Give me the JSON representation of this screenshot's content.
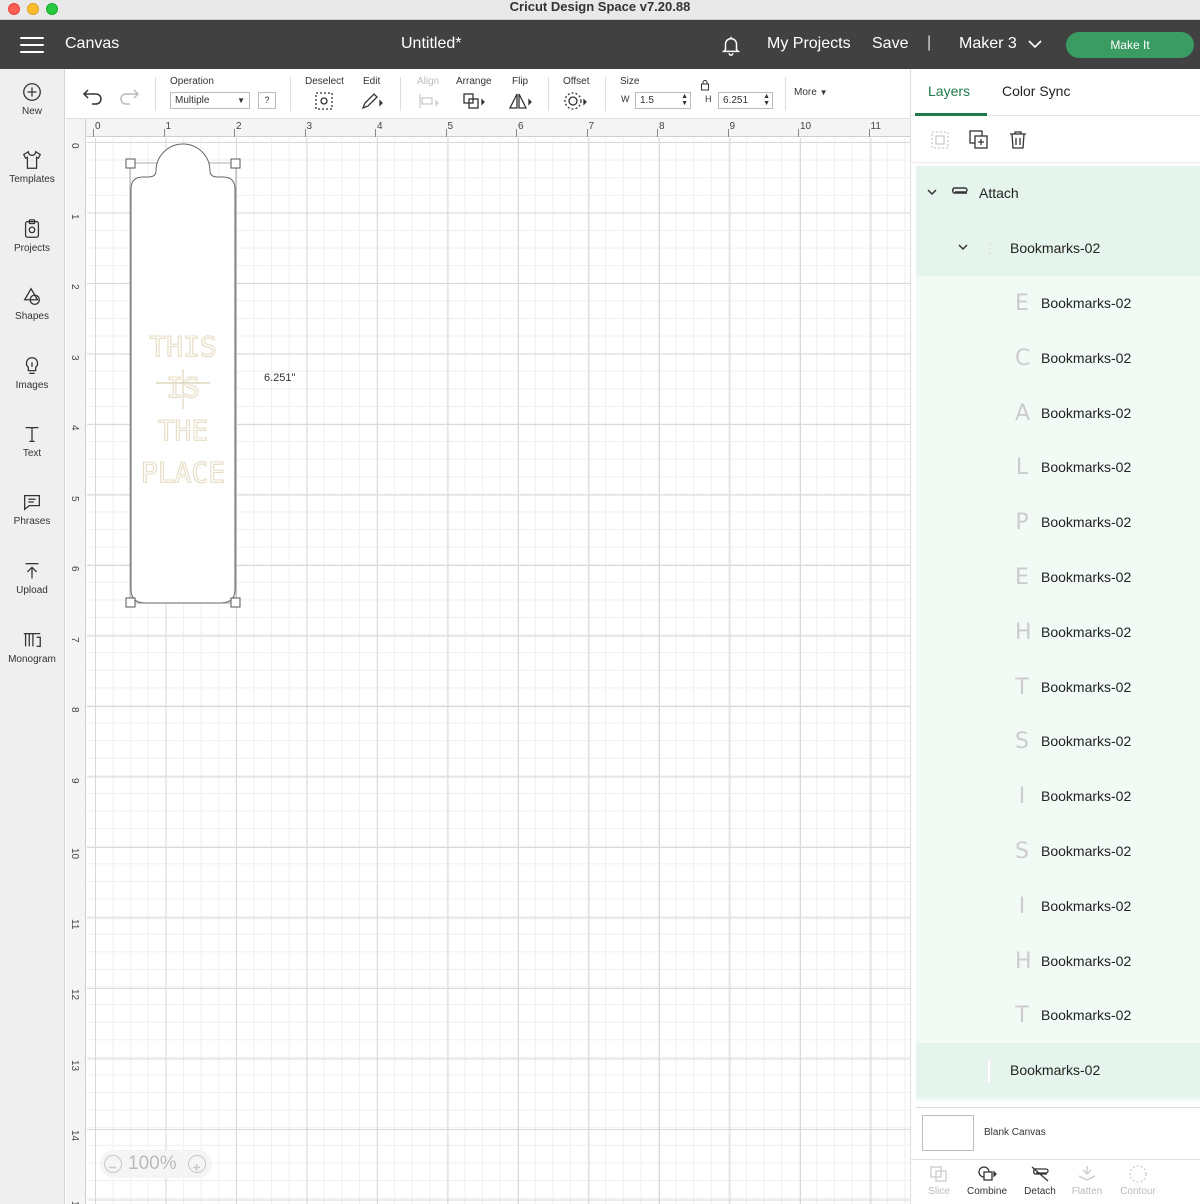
{
  "window": {
    "title": "Cricut Design Space  v7.20.88"
  },
  "header": {
    "section": "Canvas",
    "document_title": "Untitled*",
    "my_projects": "My Projects",
    "save": "Save",
    "separator": "|",
    "machine": "Maker 3",
    "make_it": "Make It"
  },
  "sidebar": {
    "items": [
      {
        "label": "New",
        "icon": "plus-circle-icon"
      },
      {
        "label": "Templates",
        "icon": "shirt-icon"
      },
      {
        "label": "Projects",
        "icon": "clipboard-icon"
      },
      {
        "label": "Shapes",
        "icon": "shapes-icon"
      },
      {
        "label": "Images",
        "icon": "lightbulb-icon"
      },
      {
        "label": "Text",
        "icon": "text-icon"
      },
      {
        "label": "Phrases",
        "icon": "speech-bubble-icon"
      },
      {
        "label": "Upload",
        "icon": "upload-icon"
      },
      {
        "label": "Monogram",
        "icon": "monogram-icon"
      }
    ]
  },
  "toolbar": {
    "operation_label": "Operation",
    "operation_value": "Multiple",
    "operation_help": "?",
    "deselect": "Deselect",
    "edit": "Edit",
    "align": "Align",
    "arrange": "Arrange",
    "flip": "Flip",
    "offset": "Offset",
    "size": "Size",
    "w_label": "W",
    "w_value": "1.5",
    "h_label": "H",
    "h_value": "6.251",
    "more": "More"
  },
  "canvas": {
    "ruler_top": [
      "0",
      "1",
      "2",
      "3",
      "4",
      "5",
      "6",
      "7",
      "8",
      "9",
      "10",
      "11"
    ],
    "ruler_left": [
      "0",
      "1",
      "2",
      "3",
      "4",
      "5",
      "6",
      "7",
      "8",
      "9",
      "10",
      "11",
      "12",
      "13",
      "14",
      "15"
    ],
    "height_readout": "6.251\"",
    "design_text": [
      "THIS",
      "IS",
      "THE",
      "PLACE"
    ],
    "zoom": "100%"
  },
  "panel": {
    "tabs": [
      "Layers",
      "Color Sync"
    ],
    "active_tab": "Layers",
    "attach_label": "Attach",
    "group_label": "Bookmarks-02",
    "layers": [
      {
        "glyph": "E",
        "name": "Bookmarks-02"
      },
      {
        "glyph": "C",
        "name": "Bookmarks-02"
      },
      {
        "glyph": "A",
        "name": "Bookmarks-02"
      },
      {
        "glyph": "L",
        "name": "Bookmarks-02"
      },
      {
        "glyph": "P",
        "name": "Bookmarks-02"
      },
      {
        "glyph": "E",
        "name": "Bookmarks-02"
      },
      {
        "glyph": "H",
        "name": "Bookmarks-02"
      },
      {
        "glyph": "T",
        "name": "Bookmarks-02"
      },
      {
        "glyph": "S",
        "name": "Bookmarks-02"
      },
      {
        "glyph": "I",
        "name": "Bookmarks-02"
      },
      {
        "glyph": "S",
        "name": "Bookmarks-02"
      },
      {
        "glyph": "I",
        "name": "Bookmarks-02"
      },
      {
        "glyph": "H",
        "name": "Bookmarks-02"
      },
      {
        "glyph": "T",
        "name": "Bookmarks-02"
      }
    ],
    "base_layer": "Bookmarks-02",
    "blank_canvas": "Blank Canvas",
    "bottom_tools": [
      {
        "label": "Slice",
        "enabled": false
      },
      {
        "label": "Combine",
        "enabled": true
      },
      {
        "label": "Detach",
        "enabled": true
      },
      {
        "label": "Flatten",
        "enabled": false
      },
      {
        "label": "Contour",
        "enabled": false
      }
    ]
  },
  "colors": {
    "header_bg": "#414142",
    "make_it_green": "#3a9b63",
    "active_tab": "#1f7a4a",
    "layer_bg": "#f2faf6",
    "design_text": "#e6dcc3"
  }
}
